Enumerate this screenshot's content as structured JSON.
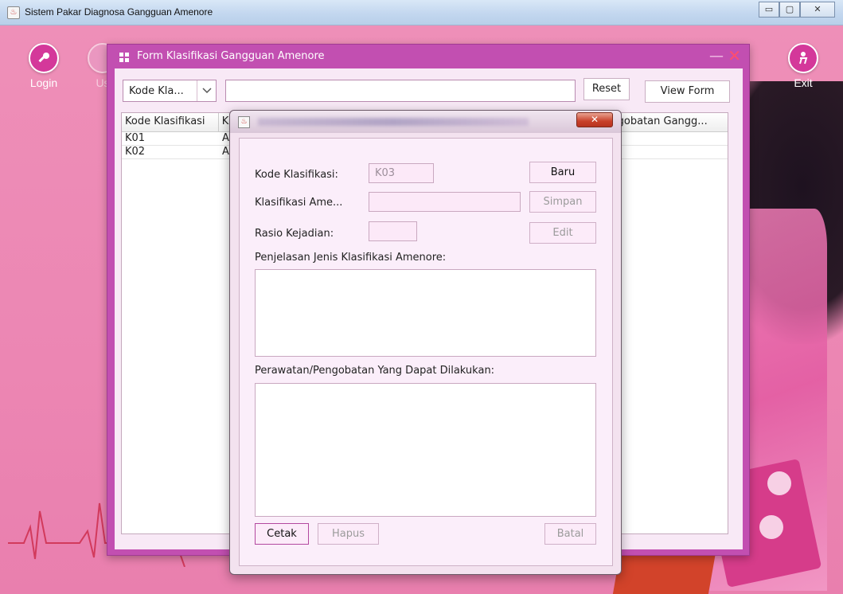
{
  "window": {
    "title": "Sistem Pakar Diagnosa Gangguan Amenore",
    "controls": {
      "minimize": "▭",
      "maximize": "▢",
      "close": "✕"
    }
  },
  "sidebar": {
    "login_label": "Login",
    "user_label": "Us",
    "exit_label": "Exit"
  },
  "form": {
    "title": "Form Klasifikasi Gangguan Amenore",
    "close_glyph": "✕",
    "minimize_glyph": "—",
    "search": {
      "combo_value": "Kode Kla...",
      "input_value": ""
    },
    "reset_label": "Reset",
    "view_form_label": "View Form",
    "table": {
      "headers": [
        "Kode Klasifikasi",
        "K",
        "",
        "",
        "",
        "ngobatan Gangg..."
      ],
      "rows": [
        [
          "K01",
          "A"
        ],
        [
          "K02",
          "A"
        ]
      ]
    }
  },
  "dialog": {
    "close_glyph": "✕",
    "kode_label": "Kode Klasifikasi:",
    "kode_value": "K03",
    "klasifikasi_label": "Klasifikasi Ame...",
    "klasifikasi_value": "",
    "rasio_label": "Rasio Kejadian:",
    "rasio_value": "",
    "penjelasan_label": "Penjelasan Jenis Klasifikasi Amenore:",
    "perawatan_label": "Perawatan/Pengobatan Yang Dapat Dilakukan:",
    "buttons": {
      "baru": "Baru",
      "simpan": "Simpan",
      "edit": "Edit",
      "cetak": "Cetak",
      "hapus": "Hapus",
      "batal": "Batal"
    }
  }
}
